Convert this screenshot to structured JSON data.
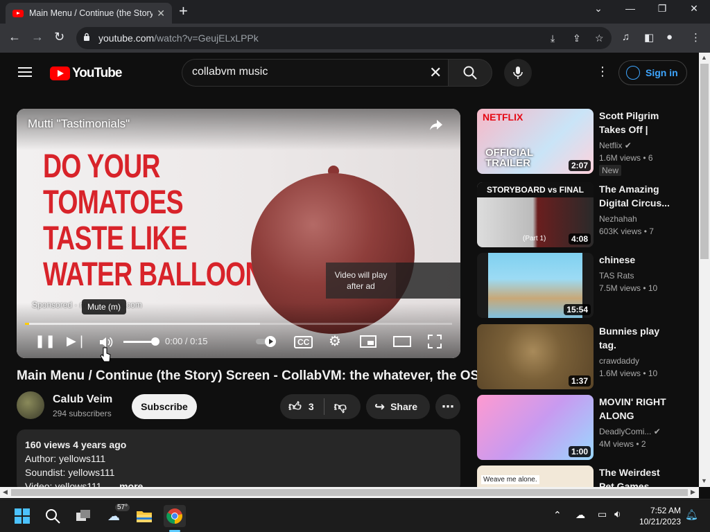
{
  "browser": {
    "tab_title": "Main Menu / Continue (the Story",
    "url_domain": "youtube.com",
    "url_path": "/watch?v=GeujELxLPPk"
  },
  "youtube": {
    "logo_text": "YouTube",
    "search_value": "collabvm music",
    "sign_in": "Sign in"
  },
  "player": {
    "ad_title": "Mutti \"Tastimonials\"",
    "headline": "DO YOUR\nTOMATOES\nTASTE LIKE\nWATER BALLOONS?",
    "wait_text": "Video will play after ad",
    "sponsored_text": "Sponsored · ",
    "sponsored_domain": "mutti-parma.com",
    "tooltip": "Mute (m)",
    "time": "0:00 / 0:15",
    "progress_fraction": 0.01,
    "buffer_fraction": 0.55,
    "volume_fraction": 1.0
  },
  "video": {
    "title": "Main Menu / Continue (the Story) Screen - CollabVM: the whatever, the OST",
    "channel": "Calub Veim",
    "subscribers": "294 subscribers",
    "subscribe": "Subscribe",
    "likes": "3",
    "share": "Share",
    "desc_meta": "160 views  4 years ago",
    "desc_line1": "Author: yellows111",
    "desc_line2": "Soundist: yellows111",
    "desc_line3": "Video: yellows111",
    "desc_more": "...more"
  },
  "recommendations": [
    {
      "title": "Scott Pilgrim Takes Off |",
      "channel": "Netflix",
      "meta": "1.6M views • 6",
      "duration": "2:07",
      "badge": "New",
      "thumb_text": "NETFLIX",
      "thumb_text2": "OFFICIAL TRAILER"
    },
    {
      "title": "The Amazing Digital Circus...",
      "channel": "Nezhahah",
      "meta": "603K views • 7",
      "duration": "4:08",
      "thumb_text": "STORYBOARD vs FINAL",
      "thumb_text2": "(Part 1)"
    },
    {
      "title": "chinese",
      "channel": "TAS Rats",
      "meta": "7.5M views • 10",
      "duration": "15:54"
    },
    {
      "title": "Bunnies play tag.",
      "channel": "crawdaddy",
      "meta": "1.6M views • 10",
      "duration": "1:37"
    },
    {
      "title": "MOVIN' RIGHT ALONG",
      "channel": "DeadlyComi...",
      "meta": "4M views • 2",
      "duration": "1:00"
    },
    {
      "title": "The Weirdest Pet Games",
      "thumb_text": "Weave me alone."
    }
  ],
  "taskbar": {
    "weather": "57°",
    "time": "7:52 AM",
    "date": "10/21/2023"
  }
}
